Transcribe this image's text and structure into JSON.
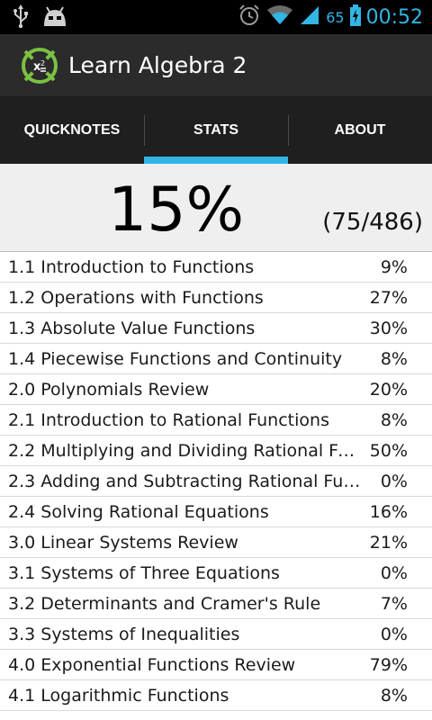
{
  "status_bar": {
    "time": "00:52",
    "battery_percent": "65",
    "icons": [
      "usb-icon",
      "cyanogen-android-icon",
      "alarm-icon",
      "wifi-icon",
      "signal-icon",
      "battery-charging-icon"
    ]
  },
  "action_bar": {
    "title": "Learn Algebra 2",
    "icon": "app-logo-icon"
  },
  "tabs": [
    {
      "label": "QUICKNOTES",
      "active": false
    },
    {
      "label": "STATS",
      "active": true
    },
    {
      "label": "ABOUT",
      "active": false
    }
  ],
  "summary": {
    "percent": "15%",
    "count": "(75/486)"
  },
  "sections": [
    {
      "name": "1.1 Introduction to Functions",
      "percent": "9%"
    },
    {
      "name": "1.2 Operations with Functions",
      "percent": "27%"
    },
    {
      "name": "1.3 Absolute Value Functions",
      "percent": "30%"
    },
    {
      "name": "1.4 Piecewise Functions and Continuity",
      "percent": "8%"
    },
    {
      "name": "2.0 Polynomials Review",
      "percent": "20%"
    },
    {
      "name": "2.1 Introduction to Rational Functions",
      "percent": "8%"
    },
    {
      "name": "2.2 Multiplying and Dividing Rational Fu…",
      "percent": "50%"
    },
    {
      "name": "2.3 Adding and Subtracting Rational Fu…",
      "percent": "0%"
    },
    {
      "name": "2.4 Solving Rational Equations",
      "percent": "16%"
    },
    {
      "name": "3.0 Linear Systems Review",
      "percent": "21%"
    },
    {
      "name": "3.1 Systems of Three Equations",
      "percent": "0%"
    },
    {
      "name": "3.2 Determinants and Cramer's Rule",
      "percent": "7%"
    },
    {
      "name": "3.3 Systems of Inequalities",
      "percent": "0%"
    },
    {
      "name": "4.0 Exponential Functions Review",
      "percent": "79%"
    },
    {
      "name": "4.1 Logarithmic Functions",
      "percent": "8%"
    }
  ],
  "colors": {
    "accent": "#33b5e5",
    "logo_green": "#7bc142"
  }
}
